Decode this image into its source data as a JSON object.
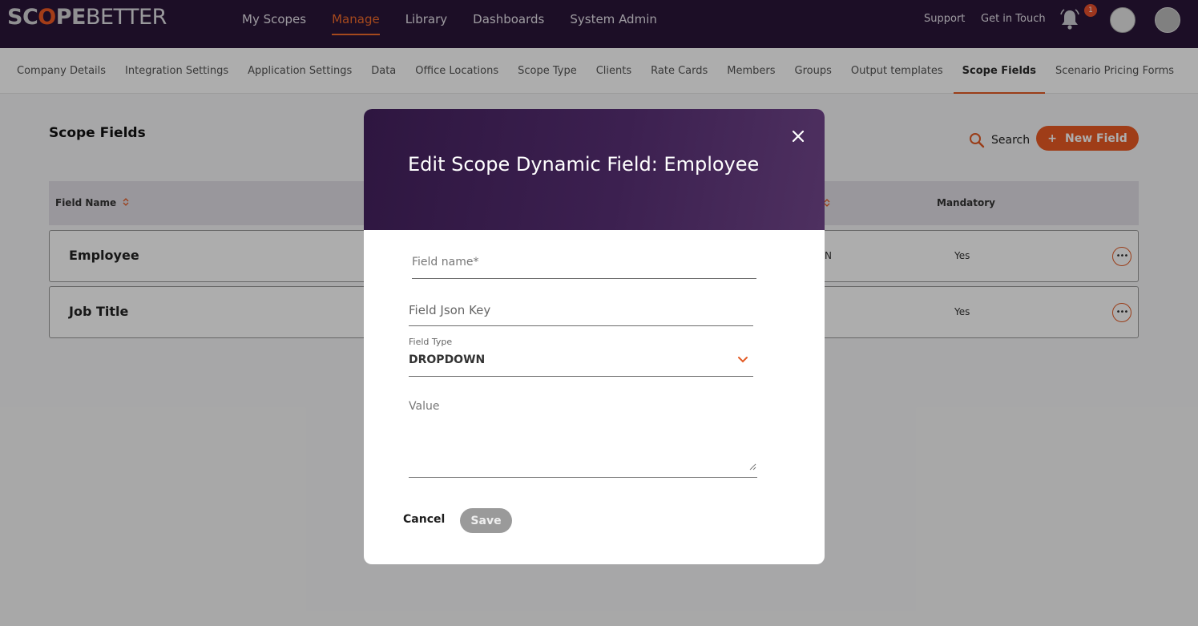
{
  "header": {
    "logo": {
      "scope_pre": "SC",
      "scope_accent": "O",
      "scope_post": "PE",
      "better": "BETTER"
    },
    "nav": [
      "My Scopes",
      "Manage",
      "Library",
      "Dashboards",
      "System Admin"
    ],
    "active_nav": "Manage",
    "support": "Support",
    "get_in_touch": "Get in Touch",
    "notification_count": "1"
  },
  "subnav": {
    "items": [
      "Company Details",
      "Integration Settings",
      "Application Settings",
      "Data",
      "Office Locations",
      "Scope Type",
      "Clients",
      "Rate Cards",
      "Members",
      "Groups",
      "Output templates",
      "Scope Fields",
      "Scenario Pricing Forms"
    ],
    "active": "Scope Fields"
  },
  "page": {
    "title": "Scope Fields",
    "search_label": "Search",
    "new_field_plus": "+",
    "new_field_label": "New Field"
  },
  "table": {
    "headers": {
      "field_name": "Field Name",
      "mandatory": "Mandatory"
    },
    "rows": [
      {
        "name": "Employee",
        "mid": "N",
        "mandatory": "Yes",
        "more": "•••"
      },
      {
        "name": "Job Title",
        "mid": "",
        "mandatory": "Yes",
        "more": "•••"
      }
    ]
  },
  "modal": {
    "title": "Edit Scope Dynamic Field: Employee",
    "field_name_label": "Field name*",
    "json_key_label": "Field Json Key",
    "field_type_label": "Field Type",
    "field_type_value": "DROPDOWN",
    "value_label": "Value",
    "cancel": "Cancel",
    "save": "Save"
  },
  "colors": {
    "accent": "#ea5a24",
    "brand_dark": "#2a1538"
  }
}
